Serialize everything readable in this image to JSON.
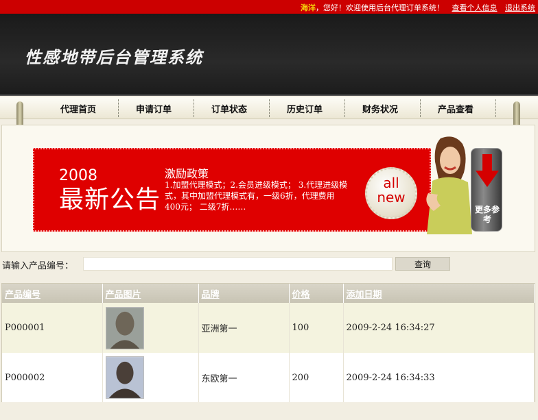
{
  "topbar": {
    "user": "海洋",
    "greeting": "，您好！欢迎使用后台代理订单系统！",
    "profile_link": "查看个人信息",
    "logout_link": "退出系统"
  },
  "header": {
    "title": "性感地带后台管理系统"
  },
  "nav": {
    "items": [
      "代理首页",
      "申请订单",
      "订单状态",
      "历史订单",
      "财务状况",
      "产品查看"
    ]
  },
  "banner": {
    "year": "2008",
    "headline": "最新公告",
    "policy_title": "激励政策",
    "policy_text": "1.加盟代理模式；2.会员进级模式； 3.代理进级模式，其中加盟代理模式有，一级6折，代理费用400元； 二级7折……",
    "badge_line1": "all",
    "badge_line2": "new",
    "more_label": "更多参考"
  },
  "search": {
    "label": "请输入产品编号：",
    "value": "",
    "button": "查询"
  },
  "table": {
    "headers": [
      "产品编号",
      "产品图片",
      "品牌",
      "价格",
      "添加日期"
    ],
    "rows": [
      {
        "id": "P000001",
        "brand": "亚洲第一",
        "price": "100",
        "date": "2009-2-24 16:34:27"
      },
      {
        "id": "P000002",
        "brand": "东欧第一",
        "price": "200",
        "date": "2009-2-24 16:34:33"
      }
    ]
  },
  "colors": {
    "brand_red": "#cc0000",
    "header_dark": "#1f1f1f",
    "nav_bg": "#f6f3e6"
  }
}
